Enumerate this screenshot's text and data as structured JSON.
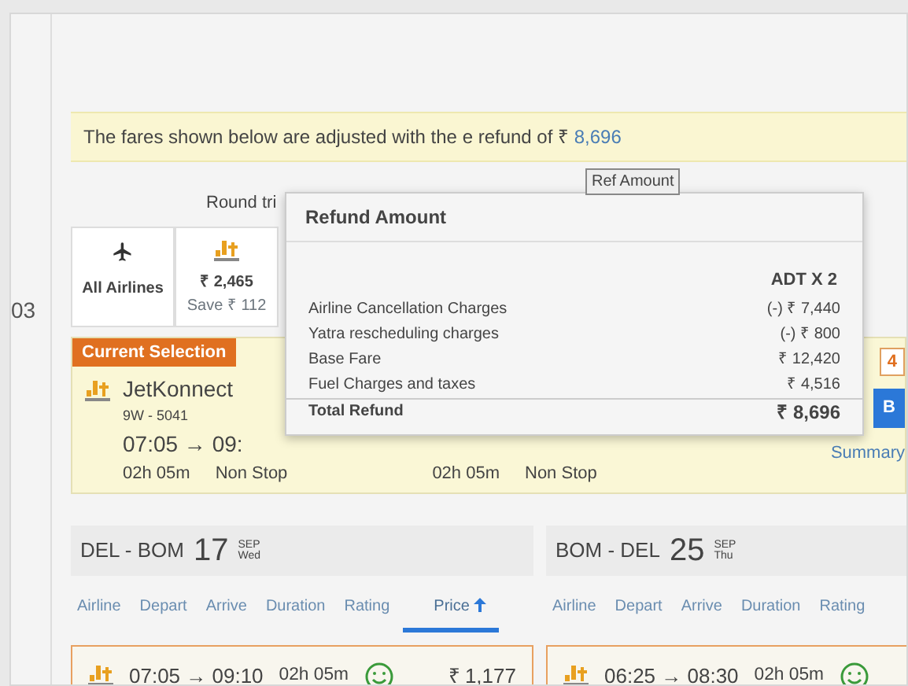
{
  "notice": {
    "text": "The fares shown below are adjusted with the",
    "magnified_text": "e refund of ₹",
    "amount": "8,696"
  },
  "tooltip": "Ref Amount",
  "left_strip": [
    "03"
  ],
  "trip_label": "Round tri",
  "airline_filters": [
    {
      "kind": "all",
      "label": "All Airlines"
    },
    {
      "kind": "airline",
      "price": "₹ 2,465",
      "save": "Save ₹ 112"
    }
  ],
  "current_selection": {
    "badge": "Current Selection",
    "airline": "JetKonnect",
    "flight": "9W - 5041",
    "times": "07:05 → 09:",
    "duration": "02h 05m",
    "stops": "Non Stop",
    "duration_2": "02h 05m",
    "stops_2": "Non Stop",
    "fare_tag": "4",
    "link": "Summary",
    "button": "B"
  },
  "refund_popup": {
    "title": "Refund Amount",
    "column": "ADT X 2",
    "rows": [
      {
        "label": "Airline Cancellation Charges",
        "value": "(-) ₹ 7,440",
        "total": false
      },
      {
        "label": "Yatra rescheduling charges",
        "value": "(-) ₹ 800",
        "total": false
      },
      {
        "label": "Base Fare",
        "value": "₹ 12,420",
        "total": false
      },
      {
        "label": "Fuel Charges and taxes",
        "value": "₹ 4,516",
        "total": false
      },
      {
        "label": "Total Refund",
        "value": "₹ 8,696",
        "total": true
      }
    ]
  },
  "legs": [
    {
      "route": "DEL - BOM",
      "day": "17",
      "month": "SEP",
      "weekday": "Wed",
      "sort_tabs": [
        {
          "label": "Airline",
          "selected": false
        },
        {
          "label": "Depart",
          "selected": false
        },
        {
          "label": "Arrive",
          "selected": false
        },
        {
          "label": "Duration",
          "selected": false
        },
        {
          "label": "Rating",
          "selected": false
        },
        {
          "label": "Price",
          "selected": true
        }
      ],
      "flights": [
        {
          "times": "07:05 → 09:10",
          "duration": "02h 05m",
          "price": "₹ 1,177"
        }
      ]
    },
    {
      "route": "BOM - DEL",
      "day": "25",
      "month": "SEP",
      "weekday": "Thu",
      "sort_tabs": [
        {
          "label": "Airline",
          "selected": false
        },
        {
          "label": "Depart",
          "selected": false
        },
        {
          "label": "Arrive",
          "selected": false
        },
        {
          "label": "Duration",
          "selected": false
        },
        {
          "label": "Rating",
          "selected": false
        }
      ],
      "flights": [
        {
          "times": "06:25 → 08:30",
          "duration": "02h 05m"
        }
      ]
    }
  ]
}
